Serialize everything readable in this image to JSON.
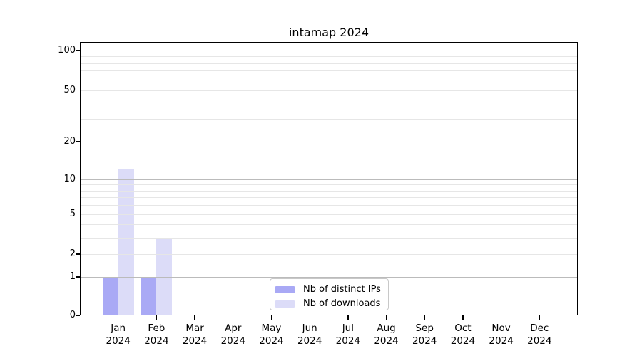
{
  "title": "intamap 2024",
  "colors": {
    "distinct_ips": "#a9a9f5",
    "downloads": "#dcdcf8",
    "grid_major": "#bbbbbb",
    "grid_minor": "#e6e6e6",
    "axis": "#000000",
    "legend_border": "#c8c8c8"
  },
  "legend": {
    "items": [
      {
        "label": "Nb of distinct IPs",
        "swatch": "#a9a9f5"
      },
      {
        "label": "Nb of downloads",
        "swatch": "#dcdcf8"
      }
    ]
  },
  "chart_data": {
    "type": "bar",
    "title": "intamap 2024",
    "categories": [
      "Jan",
      "Feb",
      "Mar",
      "Apr",
      "May",
      "Jun",
      "Jul",
      "Aug",
      "Sep",
      "Oct",
      "Nov",
      "Dec"
    ],
    "year_label": "2024",
    "series": [
      {
        "name": "Nb of distinct IPs",
        "color": "#a9a9f5",
        "values": [
          1,
          1,
          0,
          0,
          0,
          0,
          0,
          0,
          0,
          0,
          0,
          0
        ]
      },
      {
        "name": "Nb of downloads",
        "color": "#dcdcf8",
        "values": [
          12,
          3,
          0,
          0,
          0,
          0,
          0,
          0,
          0,
          0,
          0,
          0
        ]
      }
    ],
    "xlabel": "",
    "ylabel": "",
    "y_scale": "log1p",
    "ylim": [
      0,
      110
    ],
    "y_tick_values": [
      0,
      1,
      2,
      5,
      10,
      20,
      50,
      100
    ],
    "y_major_gridlines": [
      1,
      10,
      100
    ],
    "y_minor_gridlines": [
      2,
      3,
      4,
      5,
      6,
      7,
      8,
      9,
      20,
      30,
      40,
      50,
      60,
      70,
      80,
      90
    ],
    "grid": true,
    "legend_position": "lower center inside plot"
  }
}
